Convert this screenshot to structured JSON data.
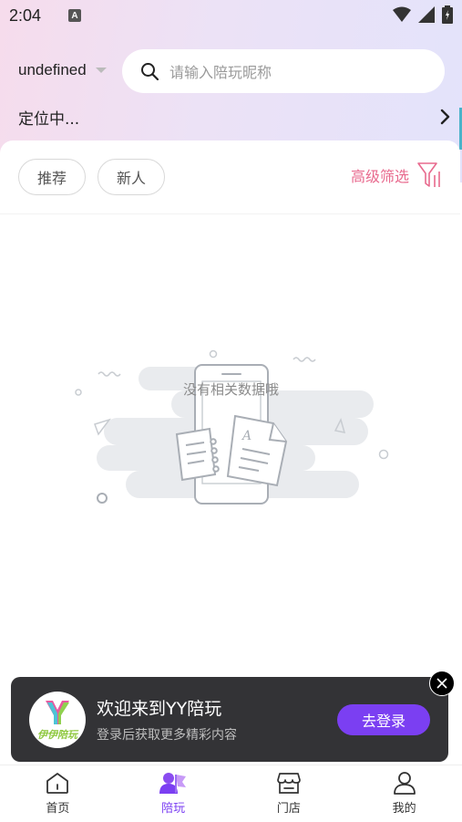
{
  "status": {
    "time": "2:04",
    "a_badge": "A"
  },
  "header": {
    "city": "undefined",
    "search_placeholder": "请输入陪玩昵称",
    "location": "定位中..."
  },
  "filters": {
    "chips": [
      {
        "label": "推荐"
      },
      {
        "label": "新人"
      }
    ],
    "advanced_label": "高级筛选"
  },
  "empty": {
    "text": "没有相关数据哦"
  },
  "login_banner": {
    "logo_text": "伊伊陪玩",
    "title": "欢迎来到YY陪玩",
    "subtitle": "登录后获取更多精彩内容",
    "button": "去登录"
  },
  "tabs": [
    {
      "label": "首页",
      "icon": "home-icon",
      "active": false
    },
    {
      "label": "陪玩",
      "icon": "companion-icon",
      "active": true
    },
    {
      "label": "门店",
      "icon": "store-icon",
      "active": false
    },
    {
      "label": "我的",
      "icon": "profile-icon",
      "active": false
    }
  ],
  "colors": {
    "accent": "#7b3ff2",
    "advanced": "#e86a8e",
    "banner_bg": "#333336"
  }
}
